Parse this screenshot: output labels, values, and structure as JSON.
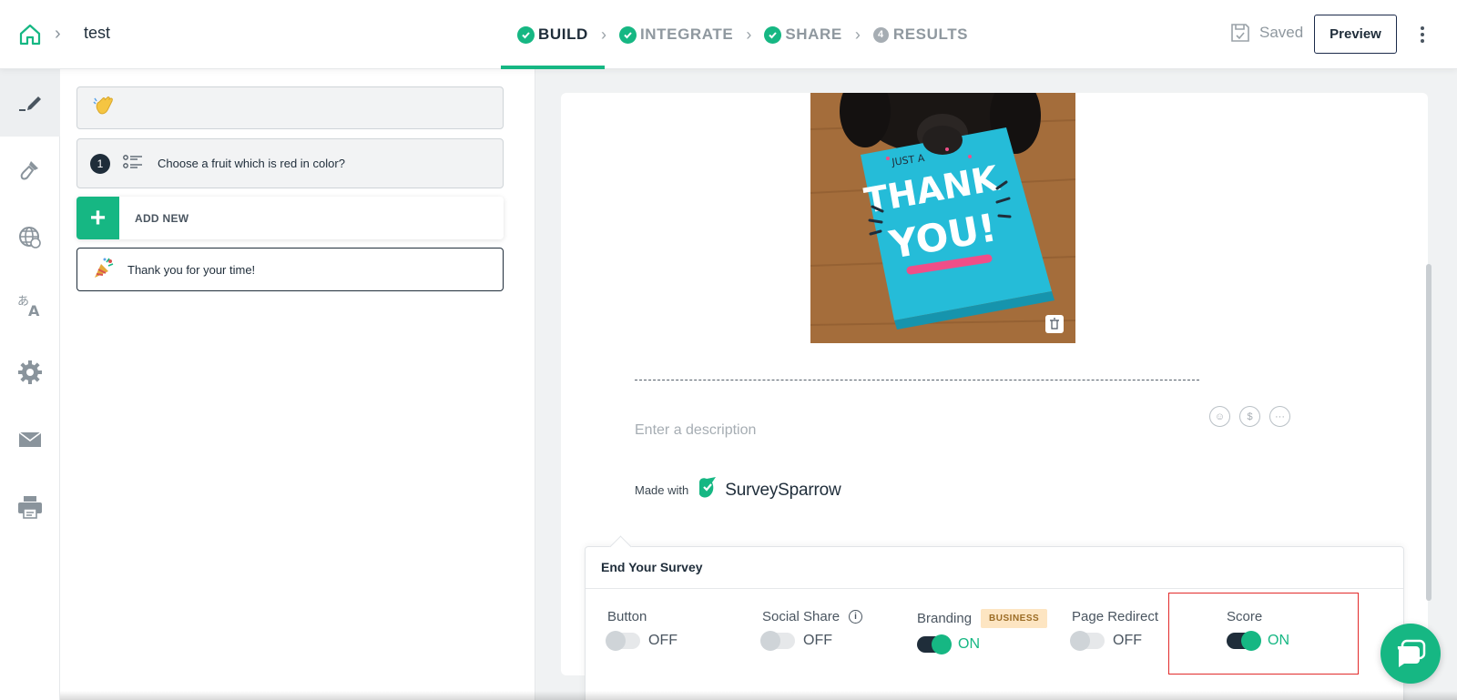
{
  "header": {
    "breadcrumb_title": "test",
    "steps": [
      {
        "label": "BUILD",
        "state": "done",
        "active": true
      },
      {
        "label": "INTEGRATE",
        "state": "done",
        "active": false
      },
      {
        "label": "SHARE",
        "state": "done",
        "active": false
      },
      {
        "label": "RESULTS",
        "state": "number",
        "number": "4",
        "active": false
      }
    ],
    "saved_label": "Saved",
    "preview_label": "Preview"
  },
  "rail": {
    "items": [
      "edit-icon",
      "paintbrush-icon",
      "globe-icon",
      "translate-icon",
      "gear-icon",
      "mail-icon",
      "printer-icon"
    ]
  },
  "questions": {
    "welcome_icon": "waving-hand-icon",
    "q1": {
      "number": "1",
      "text": "Choose a fruit which is red in color?"
    },
    "add_new_label": "ADD NEW",
    "thanks": {
      "text": "Thank you for your time!"
    }
  },
  "preview": {
    "photo_text_top": "JUST A",
    "photo_text_main_1": "THANK",
    "photo_text_main_2": "YOU!",
    "description_placeholder": "Enter a description",
    "made_with": "Made with",
    "brand": "SurveySparrow"
  },
  "end_survey": {
    "title": "End Your Survey",
    "options": [
      {
        "label": "Button",
        "state": "OFF",
        "on": false
      },
      {
        "label": "Social Share",
        "state": "OFF",
        "on": false
      },
      {
        "label": "Branding",
        "state": "ON",
        "on": true,
        "badge": "BUSINESS"
      },
      {
        "label": "Page Redirect",
        "state": "OFF",
        "on": false
      },
      {
        "label": "Score",
        "state": "ON",
        "on": true
      }
    ]
  },
  "colors": {
    "accent": "#16b783",
    "dark": "#1f2d3a",
    "highlight": "#e22b2b"
  }
}
